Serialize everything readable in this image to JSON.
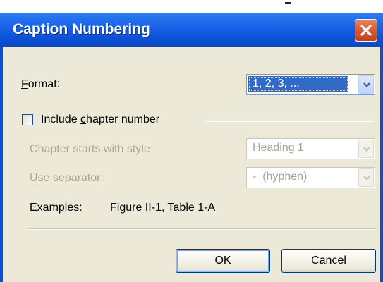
{
  "window": {
    "title": "Caption Numbering"
  },
  "format": {
    "label_first": "F",
    "label_rest": "ormat:",
    "selected": "1, 2, 3, ..."
  },
  "include_chapter": {
    "label_before": "Include ",
    "label_accel": "c",
    "label_after": "hapter number",
    "checked": false
  },
  "chapter_style": {
    "label": "Chapter starts with style",
    "value": "Heading 1"
  },
  "separator": {
    "label": "Use separator:",
    "value": "-  (hyphen)"
  },
  "examples": {
    "label": "Examples:",
    "text": "Figure II-1, Table 1-A"
  },
  "buttons": {
    "ok": "OK",
    "cancel": "Cancel"
  },
  "icons": {
    "close": "close-icon",
    "dropdown": "chevron-down-icon",
    "checkbox": "checkbox-unchecked"
  }
}
